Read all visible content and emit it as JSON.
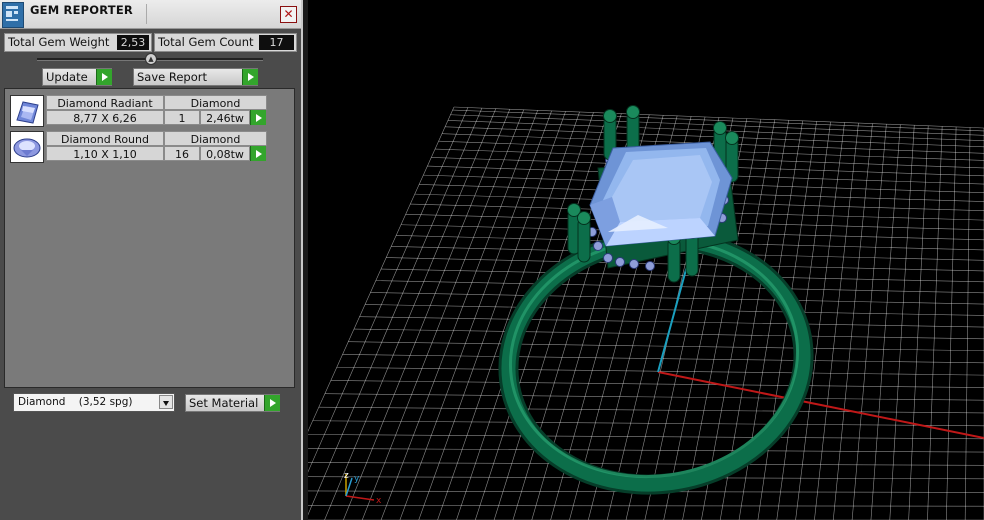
{
  "window": {
    "title": "GEM REPORTER"
  },
  "totals": {
    "weight_label": "Total Gem Weight",
    "weight_value": "2,53",
    "count_label": "Total Gem Count",
    "count_value": "17"
  },
  "toolbar": {
    "update_label": "Update",
    "save_label": "Save Report"
  },
  "gems": [
    {
      "name": "Diamond Radiant",
      "material": "Diamond",
      "size": "8,77 X 6,26",
      "count": "1",
      "weight": "2,46tw",
      "icon": "radiant-gem-icon"
    },
    {
      "name": "Diamond Round",
      "material": "Diamond",
      "size": "1,10 X 1,10",
      "count": "16",
      "weight": "0,08tw",
      "icon": "round-gem-icon"
    }
  ],
  "material_select": {
    "value": "Diamond    (3,52 spg)"
  },
  "set_material_label": "Set Material",
  "axes": {
    "x_label": "x",
    "y_label": "y",
    "z_label": "z"
  },
  "colors": {
    "grid": "#ffffff",
    "ring": "#0c6e4a",
    "gem": "#8cb3e8",
    "axis_x": "#c01818",
    "axis_y": "#1aa0c0",
    "accent_button": "#33a52c"
  }
}
